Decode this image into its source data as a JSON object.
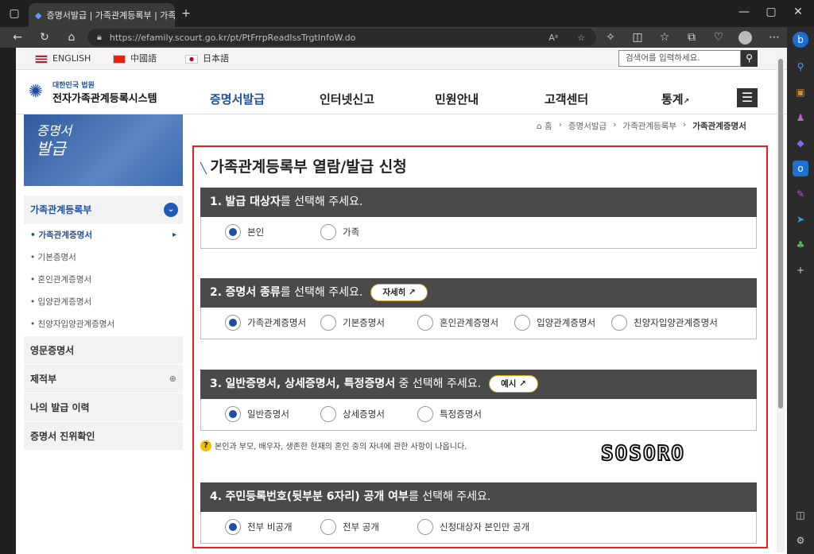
{
  "browser": {
    "tab_title": "증명서발급 | 가족관계등록부 | 가족",
    "url": "https://efamily.scourt.go.kr/pt/PtFrrpReadIssTrgtInfoW.do"
  },
  "langs": [
    "ENGLISH",
    "中國語",
    "日本語"
  ],
  "search": {
    "placeholder": "검색어를 입력하세요."
  },
  "site": {
    "subtitle": "대한민국 법원",
    "title": "전자가족관계등록시스템"
  },
  "gnb": [
    "증명서발급",
    "인터넷신고",
    "민원안내",
    "고객센터",
    "통계"
  ],
  "banner": {
    "line1": "증명서",
    "line2": "발급"
  },
  "lnb": {
    "head": "가족관계등록부",
    "subs": [
      "가족관계증명서",
      "기본증명서",
      "혼인관계증명서",
      "입양관계증명서",
      "친양자입양관계증명서"
    ],
    "mains": [
      "영문증명서",
      "제적부",
      "나의 발급 이력",
      "증명서 진위확인"
    ]
  },
  "breadcrumb": [
    "홈",
    "증명서발급",
    "가족관계등록부",
    "가족관계증명서"
  ],
  "page_title": "가족관계등록부 열람/발급 신청",
  "sections": [
    {
      "num": "1.",
      "bold": "발급 대상자",
      "rest": "를 선택해 주세요.",
      "options": [
        "본인",
        "가족"
      ]
    },
    {
      "num": "2.",
      "bold": "증명서 종류",
      "rest": "를 선택해 주세요.",
      "button": "자세히",
      "options": [
        "가족관계증명서",
        "기본증명서",
        "혼인관계증명서",
        "입양관계증명서",
        "친양자입양관계증명서"
      ]
    },
    {
      "num": "3.",
      "bold": "일반증명서, 상세증명서, 특정증명서",
      "rest": " 중 선택해 주세요.",
      "button": "예시",
      "options": [
        "일반증명서",
        "상세증명서",
        "특정증명서"
      ]
    },
    {
      "num": "4.",
      "bold": "주민등록번호(뒷부분 6자리) 공개 여부",
      "rest": "를 선택해 주세요.",
      "options": [
        "전부 비공개",
        "전부 공개",
        "신청대상자 본인만 공개"
      ]
    }
  ],
  "note": "본인과 부모, 배우자, 생존한 현재의 혼인 중의 자녀에 관한 사항이 나옵니다.",
  "watermark": "SOSORO"
}
